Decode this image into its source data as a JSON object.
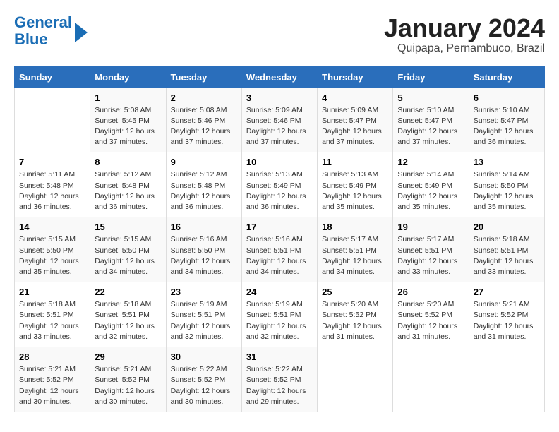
{
  "logo": {
    "line1": "General",
    "line2": "Blue"
  },
  "title": "January 2024",
  "subtitle": "Quipapa, Pernambuco, Brazil",
  "days_of_week": [
    "Sunday",
    "Monday",
    "Tuesday",
    "Wednesday",
    "Thursday",
    "Friday",
    "Saturday"
  ],
  "weeks": [
    [
      {
        "day": "",
        "sunrise": "",
        "sunset": "",
        "daylight": ""
      },
      {
        "day": "1",
        "sunrise": "Sunrise: 5:08 AM",
        "sunset": "Sunset: 5:45 PM",
        "daylight": "Daylight: 12 hours and 37 minutes."
      },
      {
        "day": "2",
        "sunrise": "Sunrise: 5:08 AM",
        "sunset": "Sunset: 5:46 PM",
        "daylight": "Daylight: 12 hours and 37 minutes."
      },
      {
        "day": "3",
        "sunrise": "Sunrise: 5:09 AM",
        "sunset": "Sunset: 5:46 PM",
        "daylight": "Daylight: 12 hours and 37 minutes."
      },
      {
        "day": "4",
        "sunrise": "Sunrise: 5:09 AM",
        "sunset": "Sunset: 5:47 PM",
        "daylight": "Daylight: 12 hours and 37 minutes."
      },
      {
        "day": "5",
        "sunrise": "Sunrise: 5:10 AM",
        "sunset": "Sunset: 5:47 PM",
        "daylight": "Daylight: 12 hours and 37 minutes."
      },
      {
        "day": "6",
        "sunrise": "Sunrise: 5:10 AM",
        "sunset": "Sunset: 5:47 PM",
        "daylight": "Daylight: 12 hours and 36 minutes."
      }
    ],
    [
      {
        "day": "7",
        "sunrise": "Sunrise: 5:11 AM",
        "sunset": "Sunset: 5:48 PM",
        "daylight": "Daylight: 12 hours and 36 minutes."
      },
      {
        "day": "8",
        "sunrise": "Sunrise: 5:12 AM",
        "sunset": "Sunset: 5:48 PM",
        "daylight": "Daylight: 12 hours and 36 minutes."
      },
      {
        "day": "9",
        "sunrise": "Sunrise: 5:12 AM",
        "sunset": "Sunset: 5:48 PM",
        "daylight": "Daylight: 12 hours and 36 minutes."
      },
      {
        "day": "10",
        "sunrise": "Sunrise: 5:13 AM",
        "sunset": "Sunset: 5:49 PM",
        "daylight": "Daylight: 12 hours and 36 minutes."
      },
      {
        "day": "11",
        "sunrise": "Sunrise: 5:13 AM",
        "sunset": "Sunset: 5:49 PM",
        "daylight": "Daylight: 12 hours and 35 minutes."
      },
      {
        "day": "12",
        "sunrise": "Sunrise: 5:14 AM",
        "sunset": "Sunset: 5:49 PM",
        "daylight": "Daylight: 12 hours and 35 minutes."
      },
      {
        "day": "13",
        "sunrise": "Sunrise: 5:14 AM",
        "sunset": "Sunset: 5:50 PM",
        "daylight": "Daylight: 12 hours and 35 minutes."
      }
    ],
    [
      {
        "day": "14",
        "sunrise": "Sunrise: 5:15 AM",
        "sunset": "Sunset: 5:50 PM",
        "daylight": "Daylight: 12 hours and 35 minutes."
      },
      {
        "day": "15",
        "sunrise": "Sunrise: 5:15 AM",
        "sunset": "Sunset: 5:50 PM",
        "daylight": "Daylight: 12 hours and 34 minutes."
      },
      {
        "day": "16",
        "sunrise": "Sunrise: 5:16 AM",
        "sunset": "Sunset: 5:50 PM",
        "daylight": "Daylight: 12 hours and 34 minutes."
      },
      {
        "day": "17",
        "sunrise": "Sunrise: 5:16 AM",
        "sunset": "Sunset: 5:51 PM",
        "daylight": "Daylight: 12 hours and 34 minutes."
      },
      {
        "day": "18",
        "sunrise": "Sunrise: 5:17 AM",
        "sunset": "Sunset: 5:51 PM",
        "daylight": "Daylight: 12 hours and 34 minutes."
      },
      {
        "day": "19",
        "sunrise": "Sunrise: 5:17 AM",
        "sunset": "Sunset: 5:51 PM",
        "daylight": "Daylight: 12 hours and 33 minutes."
      },
      {
        "day": "20",
        "sunrise": "Sunrise: 5:18 AM",
        "sunset": "Sunset: 5:51 PM",
        "daylight": "Daylight: 12 hours and 33 minutes."
      }
    ],
    [
      {
        "day": "21",
        "sunrise": "Sunrise: 5:18 AM",
        "sunset": "Sunset: 5:51 PM",
        "daylight": "Daylight: 12 hours and 33 minutes."
      },
      {
        "day": "22",
        "sunrise": "Sunrise: 5:18 AM",
        "sunset": "Sunset: 5:51 PM",
        "daylight": "Daylight: 12 hours and 32 minutes."
      },
      {
        "day": "23",
        "sunrise": "Sunrise: 5:19 AM",
        "sunset": "Sunset: 5:51 PM",
        "daylight": "Daylight: 12 hours and 32 minutes."
      },
      {
        "day": "24",
        "sunrise": "Sunrise: 5:19 AM",
        "sunset": "Sunset: 5:51 PM",
        "daylight": "Daylight: 12 hours and 32 minutes."
      },
      {
        "day": "25",
        "sunrise": "Sunrise: 5:20 AM",
        "sunset": "Sunset: 5:52 PM",
        "daylight": "Daylight: 12 hours and 31 minutes."
      },
      {
        "day": "26",
        "sunrise": "Sunrise: 5:20 AM",
        "sunset": "Sunset: 5:52 PM",
        "daylight": "Daylight: 12 hours and 31 minutes."
      },
      {
        "day": "27",
        "sunrise": "Sunrise: 5:21 AM",
        "sunset": "Sunset: 5:52 PM",
        "daylight": "Daylight: 12 hours and 31 minutes."
      }
    ],
    [
      {
        "day": "28",
        "sunrise": "Sunrise: 5:21 AM",
        "sunset": "Sunset: 5:52 PM",
        "daylight": "Daylight: 12 hours and 30 minutes."
      },
      {
        "day": "29",
        "sunrise": "Sunrise: 5:21 AM",
        "sunset": "Sunset: 5:52 PM",
        "daylight": "Daylight: 12 hours and 30 minutes."
      },
      {
        "day": "30",
        "sunrise": "Sunrise: 5:22 AM",
        "sunset": "Sunset: 5:52 PM",
        "daylight": "Daylight: 12 hours and 30 minutes."
      },
      {
        "day": "31",
        "sunrise": "Sunrise: 5:22 AM",
        "sunset": "Sunset: 5:52 PM",
        "daylight": "Daylight: 12 hours and 29 minutes."
      },
      {
        "day": "",
        "sunrise": "",
        "sunset": "",
        "daylight": ""
      },
      {
        "day": "",
        "sunrise": "",
        "sunset": "",
        "daylight": ""
      },
      {
        "day": "",
        "sunrise": "",
        "sunset": "",
        "daylight": ""
      }
    ]
  ]
}
